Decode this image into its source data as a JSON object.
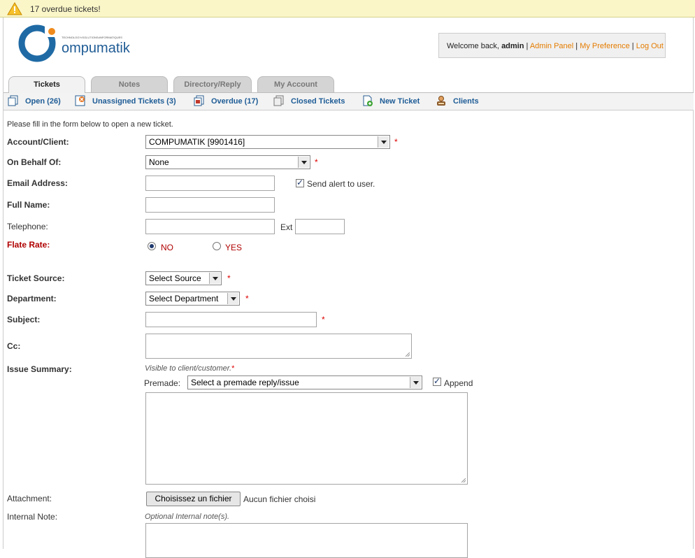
{
  "alert": {
    "text": "17 overdue tickets!"
  },
  "logo": {
    "name": "Compumatik",
    "tagline": "TECHNOLOGY•SOLUTIONS•INFORMATIQUES"
  },
  "userbox": {
    "welcome": "Welcome back,",
    "user": "admin",
    "links": [
      "Admin Panel",
      "My Preference",
      "Log Out"
    ]
  },
  "tabs": [
    {
      "label": "Tickets",
      "active": true
    },
    {
      "label": "Notes"
    },
    {
      "label": "Directory/Reply"
    },
    {
      "label": "My Account"
    }
  ],
  "subnav": [
    {
      "label": "Open (26)",
      "icon": "open-tickets-icon"
    },
    {
      "label": "Unassigned Tickets (3)",
      "icon": "unassigned-tickets-icon"
    },
    {
      "label": "Overdue (17)",
      "icon": "overdue-tickets-icon"
    },
    {
      "label": "Closed Tickets",
      "icon": "closed-tickets-icon"
    },
    {
      "label": "New Ticket",
      "icon": "new-ticket-icon"
    },
    {
      "label": "Clients",
      "icon": "clients-icon"
    }
  ],
  "form": {
    "intro": "Please fill in the form below to open a new ticket.",
    "account_label": "Account/Client:",
    "account_value": "COMPUMATIK [9901416]",
    "behalf_label": "On Behalf Of:",
    "behalf_value": "None",
    "email_label": "Email Address:",
    "send_alert_label": "Send alert to user.",
    "send_alert_checked": true,
    "fullname_label": "Full Name:",
    "telephone_label": "Telephone:",
    "ext_label": "Ext",
    "flate_label": "Flate Rate:",
    "flate_no": "NO",
    "flate_yes": "YES",
    "flate_selected": "NO",
    "source_label": "Ticket Source:",
    "source_value": "Select Source",
    "department_label": "Department:",
    "department_value": "Select Department",
    "subject_label": "Subject:",
    "cc_label": "Cc:",
    "issue_label": "Issue Summary:",
    "issue_hint": "Visible to client/customer.",
    "premade_label": "Premade:",
    "premade_value": "Select a premade reply/issue",
    "append_label": "Append",
    "append_checked": true,
    "attachment_label": "Attachment:",
    "file_button": "Choisissez un fichier",
    "file_status": "Aucun fichier choisi",
    "internal_label": "Internal Note:",
    "internal_hint": "Optional Internal note(s).",
    "required_mark": "*"
  }
}
